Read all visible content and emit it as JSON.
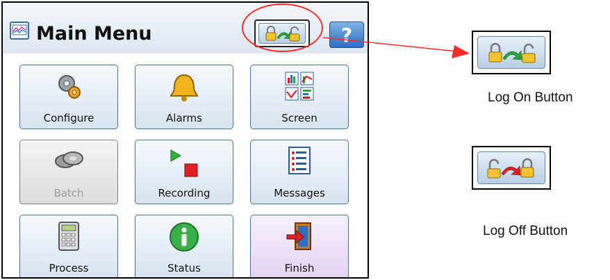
{
  "window": {
    "title": "Main Menu"
  },
  "header": {
    "help_label": "?"
  },
  "menu": {
    "tiles": [
      {
        "label": "Configure",
        "icon": "gears-icon",
        "enabled": true
      },
      {
        "label": "Alarms",
        "icon": "bell-icon",
        "enabled": true
      },
      {
        "label": "Screen",
        "icon": "screen-icon",
        "enabled": true
      },
      {
        "label": "Batch",
        "icon": "batch-icon",
        "enabled": false
      },
      {
        "label": "Recording",
        "icon": "recording-icon",
        "enabled": true
      },
      {
        "label": "Messages",
        "icon": "messages-icon",
        "enabled": true
      },
      {
        "label": "Process",
        "icon": "calculator-icon",
        "enabled": true
      },
      {
        "label": "Status",
        "icon": "info-icon",
        "enabled": true
      },
      {
        "label": "Finish",
        "icon": "exit-door-icon",
        "enabled": true
      }
    ]
  },
  "annotations": {
    "log_on": {
      "caption": "Log On Button"
    },
    "log_off": {
      "caption": "Log Off Button"
    }
  },
  "colors": {
    "callout": "#ff2b2b",
    "tile_border": "#4b6f9a",
    "help_button": "#2a6fc0"
  }
}
